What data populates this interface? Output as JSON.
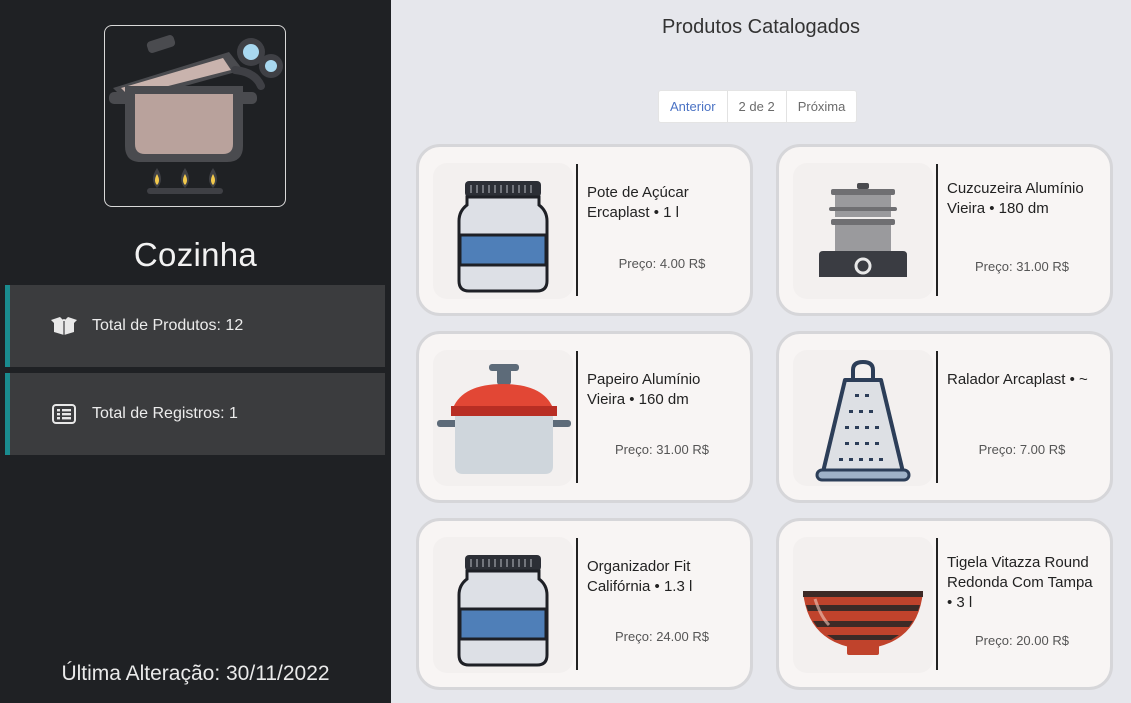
{
  "sidebar": {
    "category": "Cozinha",
    "total_products": "Total de Produtos: 12",
    "total_records": "Total de Registros: 1",
    "last_change": "Última Alteração: 30/11/2022"
  },
  "main": {
    "title": "Produtos Catalogados",
    "pager": {
      "prev": "Anterior",
      "current": "2 de 2",
      "next": "Próxima"
    },
    "products": [
      {
        "name": "Pote de Açúcar Ercaplast • 1 l",
        "price": "Preço: 4.00 R$",
        "icon": "jar-icon"
      },
      {
        "name": "Cuzcuzeira Alumínio Vieira • 180 dm",
        "price": "Preço: 31.00 R$",
        "icon": "steamer-icon"
      },
      {
        "name": "Papeiro Alumínio Vieira • 160 dm",
        "price": "Preço: 31.00 R$",
        "icon": "pot-icon"
      },
      {
        "name": "Ralador Arcaplast • ~",
        "price": "Preço: 7.00 R$",
        "icon": "grater-icon"
      },
      {
        "name": "Organizador Fit Califórnia • 1.3 l",
        "price": "Preço: 24.00 R$",
        "icon": "jar-icon"
      },
      {
        "name": "Tigela Vitazza Round Redonda Com Tampa • 3 l",
        "price": "Preço: 20.00 R$",
        "icon": "bowl-icon"
      }
    ]
  },
  "colors": {
    "sidebar": "#1f2124",
    "accent": "#1a8c8f",
    "background": "#e6e7ec"
  }
}
